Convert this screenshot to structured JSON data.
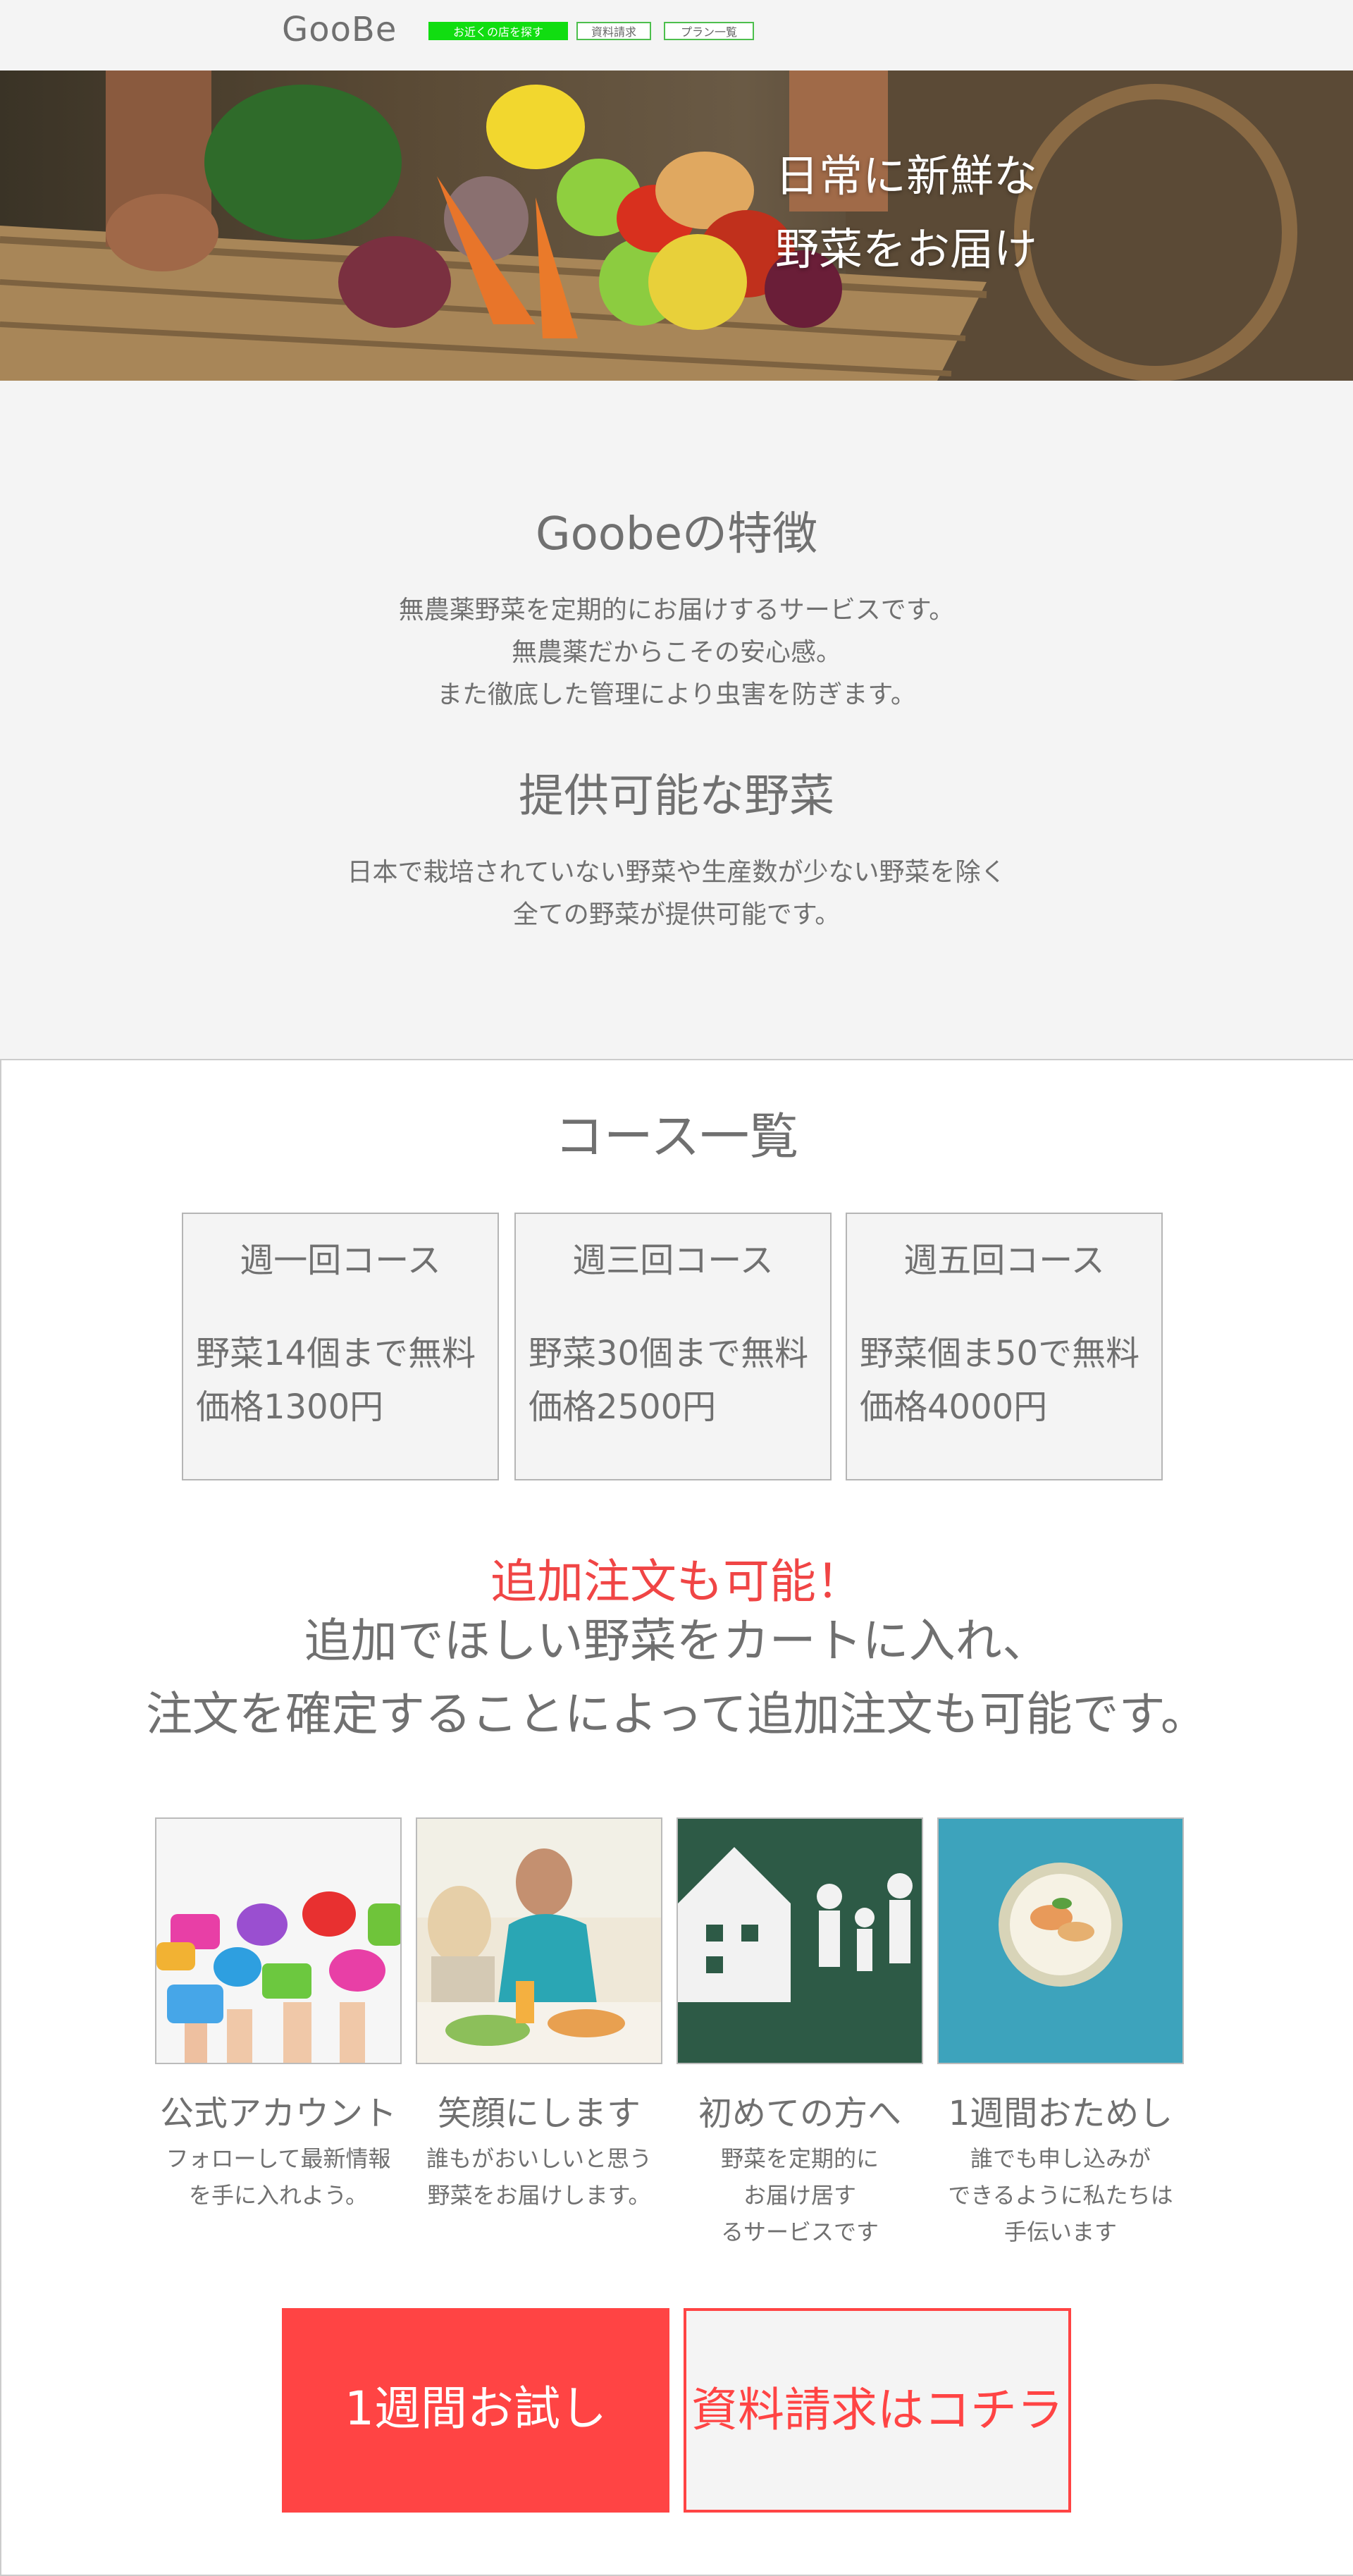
{
  "header": {
    "logo": "GooBe",
    "nav": {
      "find_store": "お近くの店を探す",
      "request_docs": "資料請求",
      "plans": "プラン一覧"
    }
  },
  "hero": {
    "line1": "日常に新鮮な",
    "line2": "野菜をお届け"
  },
  "features": {
    "title": "Goobeの特徴",
    "lines": [
      "無農薬野菜を定期的にお届けするサービスです。",
      "無農薬だからこその安心感。",
      "また徹底した管理により虫害を防ぎます。"
    ]
  },
  "vegetables": {
    "title": "提供可能な野菜",
    "lines": [
      "日本で栽培されていない野菜や生産数が少ない野菜を除く",
      "全ての野菜が提供可能です。"
    ]
  },
  "courses": {
    "title": "コース一覧",
    "items": [
      {
        "name": "週一回コース",
        "line1": "野菜14個まで無料",
        "line2": "価格1300円"
      },
      {
        "name": "週三回コース",
        "line1": "野菜30個まで無料",
        "line2": "価格2500円"
      },
      {
        "name": "週五回コース",
        "line1": "野菜個ま50で無料",
        "line2": "価格4000円"
      }
    ]
  },
  "extra_order": {
    "highlight": "追加注文も可能！",
    "line1": "追加でほしい野菜をカートに入れ、",
    "line2": "注文を確定することによって追加注文も可能です。"
  },
  "feature_cards": [
    {
      "title": "公式アカウント",
      "desc": [
        "フォローして最新情報",
        "を手に入れよう。"
      ]
    },
    {
      "title": "笑顔にします",
      "desc": [
        "誰もがおいしいと思う",
        "野菜をお届けします。"
      ]
    },
    {
      "title": "初めての方へ",
      "desc": [
        "野菜を定期的に",
        "お届け居す",
        "るサービスです"
      ]
    },
    {
      "title": "1週間おためし",
      "desc": [
        "誰でも申し込みが",
        "できるように私たちは",
        "手伝います"
      ]
    }
  ],
  "cta": {
    "trial": "1週間お試し",
    "docs": "資料請求はコチラ"
  },
  "colors": {
    "accent_red": "#ff4444",
    "nav_green": "#11dd11",
    "text_gray": "#707070",
    "background": "#f4f4f4"
  }
}
